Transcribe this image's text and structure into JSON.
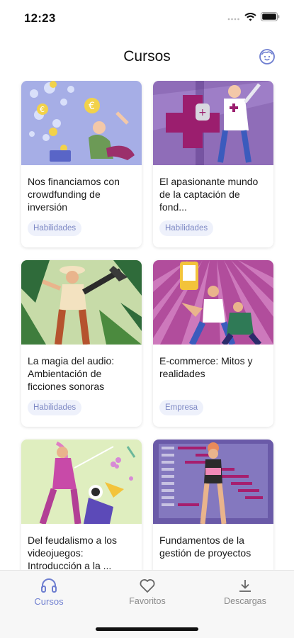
{
  "status": {
    "time": "12:23"
  },
  "header": {
    "title": "Cursos"
  },
  "courses": [
    {
      "title": "Nos financiamos con crowdfunding de inversión",
      "tag": "Habilidades"
    },
    {
      "title": "El apasionante mundo de la captación de fond...",
      "tag": "Habilidades"
    },
    {
      "title": "La magia del audio: Ambientación de ficciones sonoras",
      "tag": "Habilidades"
    },
    {
      "title": "E-commerce: Mitos y realidades",
      "tag": "Empresa"
    },
    {
      "title": "Del feudalismo a los videojuegos: Introducción a la ...",
      "tag": ""
    },
    {
      "title": "Fundamentos de la gestión de proyectos",
      "tag": ""
    }
  ],
  "tabs": [
    {
      "label": "Cursos",
      "icon": "headphones-icon",
      "active": true
    },
    {
      "label": "Favoritos",
      "icon": "heart-icon",
      "active": false
    },
    {
      "label": "Descargas",
      "icon": "download-icon",
      "active": false
    }
  ],
  "colors": {
    "accent": "#6e7ed0",
    "tag_bg": "#eef1fb",
    "tag_text": "#7d88c4"
  }
}
